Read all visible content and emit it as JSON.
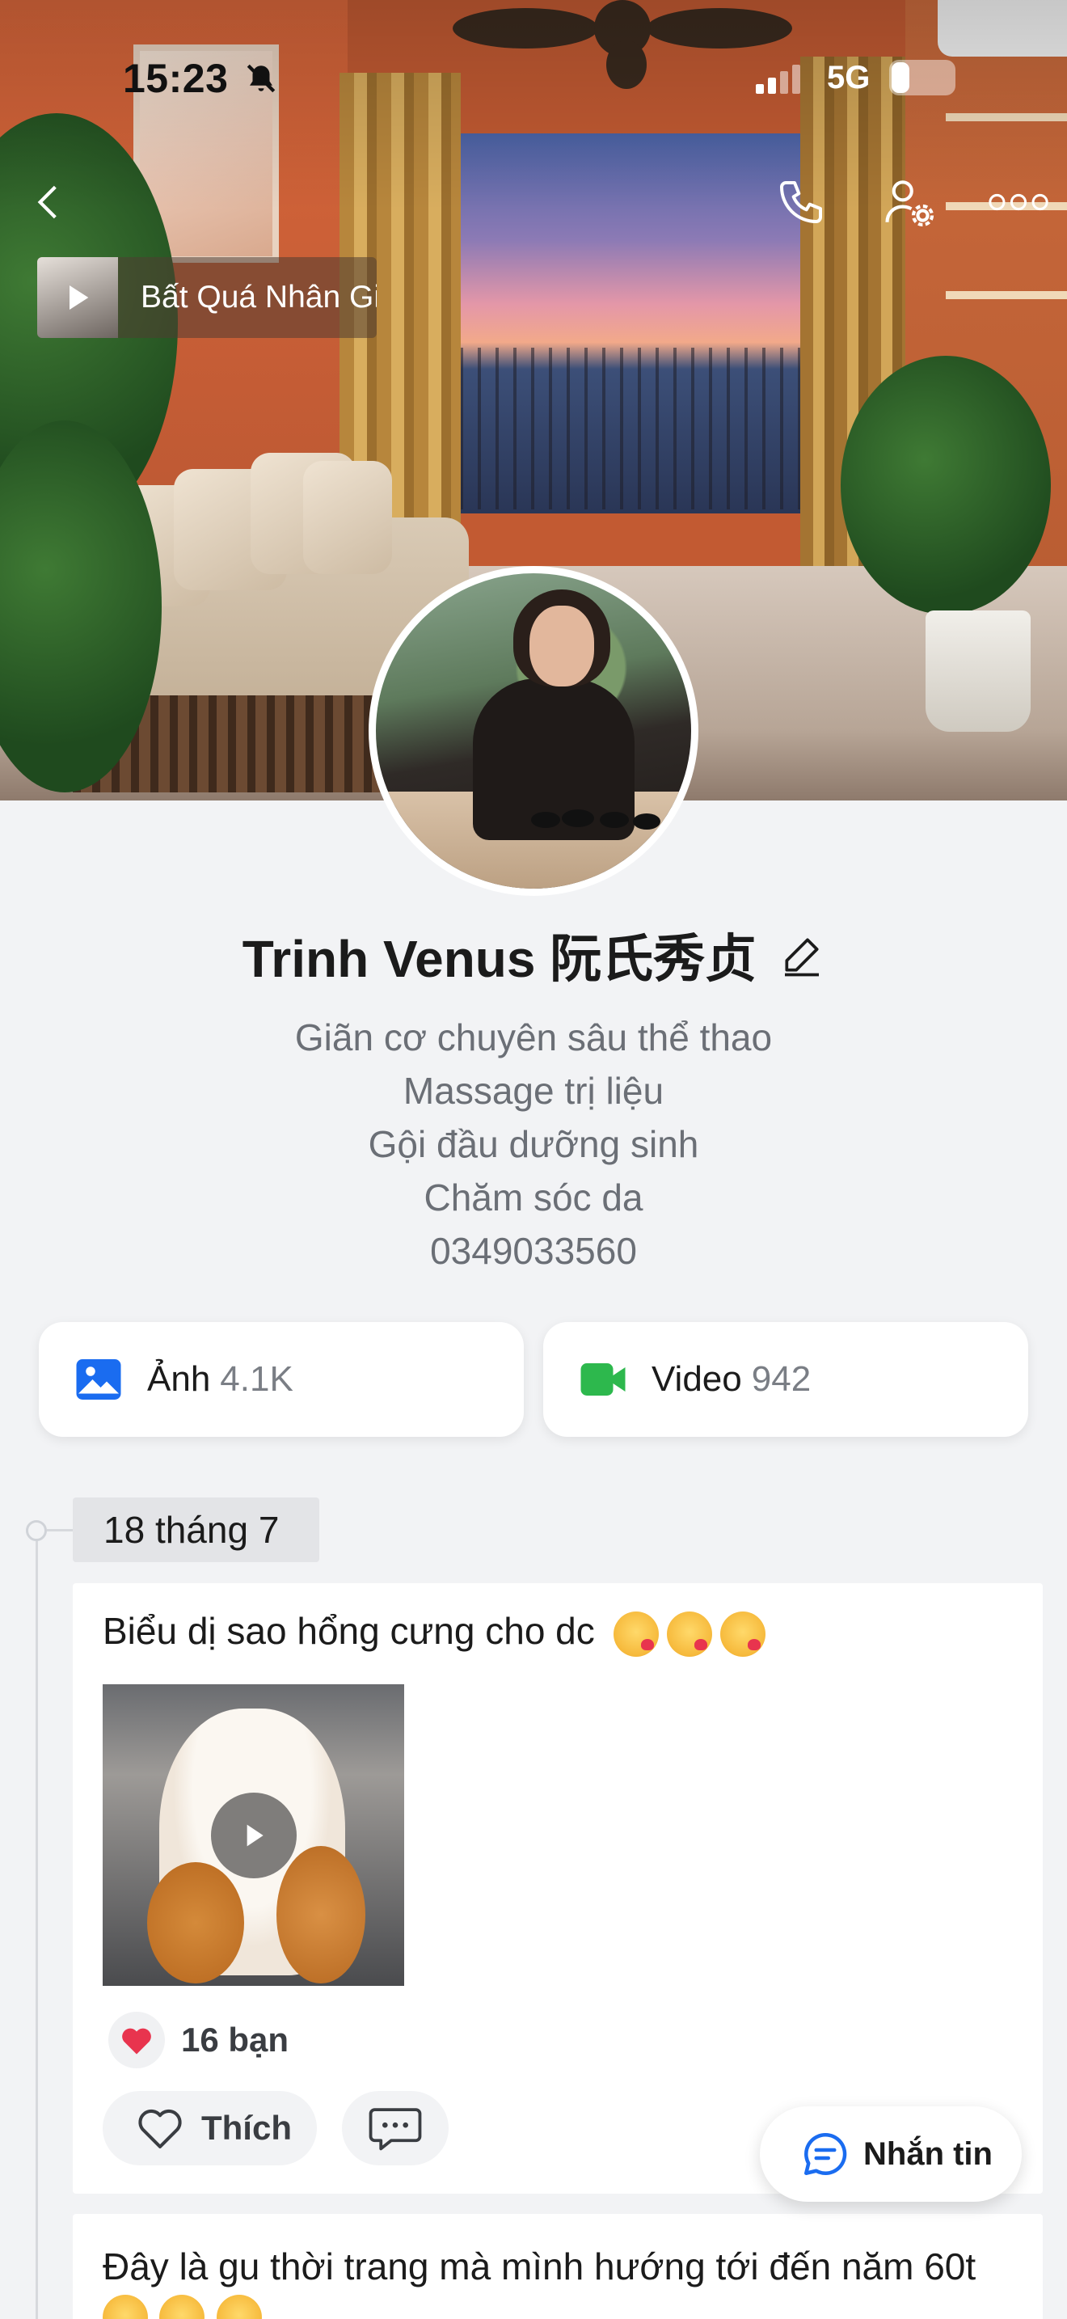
{
  "status_bar": {
    "time": "15:23",
    "network": "5G"
  },
  "music": {
    "title": "Bất Quá Nhân Gian"
  },
  "profile": {
    "name": "Trinh Venus 阮氏秀贞",
    "bio": [
      "Giãn cơ chuyên sâu thể thao",
      "Massage trị liệu",
      "Gội đầu dưỡng sinh",
      "Chăm sóc da",
      "0349033560"
    ]
  },
  "media": {
    "photos": {
      "label": "Ảnh",
      "count": "4.1K",
      "icon": "image-icon",
      "color": "#1a6cf0"
    },
    "videos": {
      "label": "Video",
      "count": "942",
      "icon": "video-camera-icon",
      "color": "#2db84d"
    }
  },
  "timeline": {
    "date": "18 tháng 7",
    "posts": [
      {
        "text": "Biểu dị sao hổng cưng cho dc",
        "emojis": [
          "kissing-heart-emoji",
          "kissing-heart-emoji",
          "kissing-heart-emoji"
        ],
        "reaction_count": "16 bạn",
        "like_label": "Thích"
      },
      {
        "text": "Đây là gu thời trang mà mình hướng tới đến năm 60t"
      }
    ]
  },
  "message_button": {
    "label": "Nhắn tin"
  },
  "colors": {
    "accent": "#1a6cf0",
    "heart": "#e8344e",
    "background": "#f2f3f5"
  }
}
